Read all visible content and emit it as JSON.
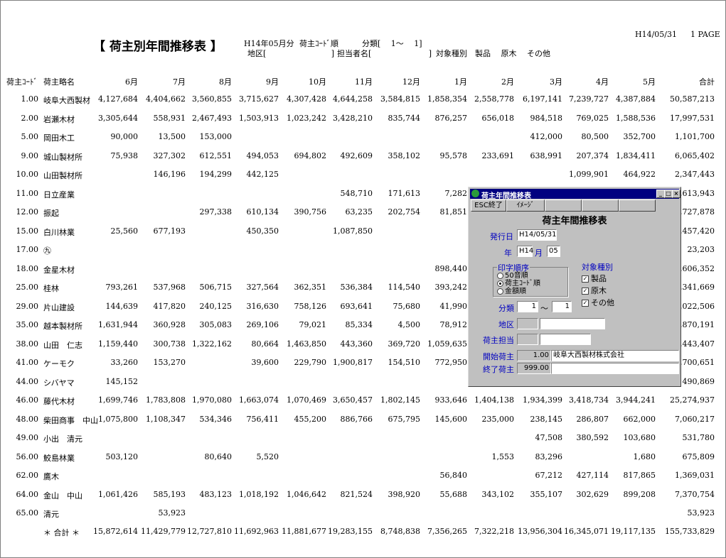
{
  "report": {
    "title": "【 荷主別年間推移表 】",
    "period": "H14年05月分",
    "order": "荷主ｺｰﾄﾞ順",
    "bunrui": "分類[　 1～　 1]",
    "chiku": "地区[　　　　　　　　 ]",
    "tantou": "担当者名[　　　　　　　 ]",
    "target": "対象種別　製品　 原木　 その他",
    "date": "H14/05/31",
    "page": "1 PAGE"
  },
  "columns": [
    "荷主ｺｰﾄﾞ",
    "荷主略名",
    "6月",
    "7月",
    "8月",
    "9月",
    "10月",
    "11月",
    "12月",
    "1月",
    "2月",
    "3月",
    "4月",
    "5月",
    "合計"
  ],
  "rows": [
    {
      "code": "1.00",
      "name": "岐阜大西製材",
      "v": [
        "4,127,684",
        "4,404,662",
        "3,560,855",
        "3,715,627",
        "4,307,428",
        "4,644,258",
        "3,584,815",
        "1,858,354",
        "2,558,778",
        "6,197,141",
        "7,239,727",
        "4,387,884",
        "50,587,213"
      ]
    },
    {
      "code": "2.00",
      "name": "岩瀬木材",
      "v": [
        "3,305,644",
        "558,931",
        "2,467,493",
        "1,503,913",
        "1,023,242",
        "3,428,210",
        "835,744",
        "876,257",
        "656,018",
        "984,518",
        "769,025",
        "1,588,536",
        "17,997,531"
      ]
    },
    {
      "code": "5.00",
      "name": "岡田木工",
      "v": [
        "90,000",
        "13,500",
        "153,000",
        "",
        "",
        "",
        "",
        "",
        "",
        "412,000",
        "80,500",
        "352,700",
        "1,101,700"
      ]
    },
    {
      "code": "9.00",
      "name": "城山製材所",
      "v": [
        "75,938",
        "327,302",
        "612,551",
        "494,053",
        "694,802",
        "492,609",
        "358,102",
        "95,578",
        "233,691",
        "638,991",
        "207,374",
        "1,834,411",
        "6,065,402"
      ]
    },
    {
      "code": "10.00",
      "name": "山田製材所",
      "v": [
        "",
        "146,196",
        "194,299",
        "442,125",
        "",
        "",
        "",
        "",
        "",
        "",
        "1,099,901",
        "464,922",
        "2,347,443"
      ]
    },
    {
      "code": "11.00",
      "name": "日立産業",
      "v": [
        "",
        "",
        "",
        "",
        "",
        "548,710",
        "171,613",
        "7,282",
        "",
        "",
        "",
        "",
        ",613,943"
      ]
    },
    {
      "code": "12.00",
      "name": "振起",
      "v": [
        "",
        "",
        "297,338",
        "610,134",
        "390,756",
        "63,235",
        "202,754",
        "81,851",
        "",
        "",
        "",
        "",
        ",727,878"
      ]
    },
    {
      "code": "15.00",
      "name": "白川林業",
      "v": [
        "25,560",
        "677,193",
        "",
        "450,350",
        "",
        "1,087,850",
        "",
        "",
        "",
        "",
        "",
        "",
        ",457,420"
      ]
    },
    {
      "code": "17.00",
      "name": "㊈",
      "v": [
        "",
        "",
        "",
        "",
        "",
        "",
        "",
        "",
        "",
        "",
        "",
        "",
        "23,203"
      ]
    },
    {
      "code": "18.00",
      "name": "金星木材",
      "v": [
        "",
        "",
        "",
        "",
        "",
        "",
        "",
        "898,440",
        "",
        "",
        "",
        "",
        ",606,352"
      ]
    },
    {
      "code": "25.00",
      "name": "桂林",
      "v": [
        "793,261",
        "537,968",
        "506,715",
        "327,564",
        "362,351",
        "536,384",
        "114,540",
        "393,242",
        "",
        "",
        "",
        "",
        ",341,669"
      ]
    },
    {
      "code": "29.00",
      "name": "片山建設",
      "v": [
        "144,639",
        "417,820",
        "240,125",
        "316,630",
        "758,126",
        "693,641",
        "75,680",
        "41,990",
        "",
        "",
        "",
        "",
        ",022,506"
      ]
    },
    {
      "code": "35.00",
      "name": "越本製材所",
      "v": [
        "1,631,944",
        "360,928",
        "305,083",
        "269,106",
        "79,021",
        "85,334",
        "4,500",
        "78,912",
        "",
        "",
        "",
        "",
        ",870,191"
      ]
    },
    {
      "code": "38.00",
      "name": "山田　仁志",
      "v": [
        "1,159,440",
        "300,738",
        "1,322,162",
        "80,664",
        "1,463,850",
        "443,360",
        "369,720",
        "1,059,635",
        "",
        "",
        "",
        "",
        ",443,407"
      ]
    },
    {
      "code": "41.00",
      "name": "ケーモク",
      "v": [
        "33,260",
        "153,270",
        "",
        "39,600",
        "229,790",
        "1,900,817",
        "154,510",
        "772,950",
        "",
        "",
        "",
        "",
        ",700,651"
      ]
    },
    {
      "code": "44.00",
      "name": "シバヤマ",
      "v": [
        "145,152",
        "",
        "",
        "",
        "",
        "",
        "",
        "",
        "",
        "",
        "",
        "",
        "490,869"
      ]
    },
    {
      "code": "46.00",
      "name": "藤代木材",
      "v": [
        "1,699,746",
        "1,783,808",
        "1,970,080",
        "1,663,074",
        "1,070,469",
        "3,650,457",
        "1,802,145",
        "933,646",
        "1,404,138",
        "1,934,399",
        "3,418,734",
        "3,944,241",
        "25,274,937"
      ]
    },
    {
      "code": "48.00",
      "name": "柴田商事　中山",
      "v": [
        "1,075,800",
        "1,108,347",
        "534,346",
        "756,411",
        "455,200",
        "886,766",
        "675,795",
        "145,600",
        "235,000",
        "238,145",
        "286,807",
        "662,000",
        "7,060,217"
      ]
    },
    {
      "code": "49.00",
      "name": "小出　清元",
      "v": [
        "",
        "",
        "",
        "",
        "",
        "",
        "",
        "",
        "",
        "47,508",
        "380,592",
        "103,680",
        "531,780"
      ]
    },
    {
      "code": "56.00",
      "name": "鮫島林業",
      "v": [
        "503,120",
        "",
        "80,640",
        "5,520",
        "",
        "",
        "",
        "",
        "1,553",
        "83,296",
        "",
        "1,680",
        "675,809"
      ]
    },
    {
      "code": "62.00",
      "name": "鷹木",
      "v": [
        "",
        "",
        "",
        "",
        "",
        "",
        "",
        "56,840",
        "",
        "67,212",
        "427,114",
        "817,865",
        "1,369,031"
      ]
    },
    {
      "code": "64.00",
      "name": "金山　中山",
      "v": [
        "1,061,426",
        "585,193",
        "483,123",
        "1,018,192",
        "1,046,642",
        "821,524",
        "398,920",
        "55,688",
        "343,102",
        "355,107",
        "302,629",
        "899,208",
        "7,370,754"
      ]
    },
    {
      "code": "65.00",
      "name": "清元",
      "v": [
        "",
        "53,923",
        "",
        "",
        "",
        "",
        "",
        "",
        "",
        "",
        "",
        "",
        "53,923"
      ]
    }
  ],
  "total": {
    "label": "＊ 合計 ＊",
    "v": [
      "15,872,614",
      "11,429,779",
      "12,727,810",
      "11,692,963",
      "11,881,677",
      "19,283,155",
      "8,748,838",
      "7,356,265",
      "7,322,218",
      "13,956,304",
      "16,345,071",
      "19,117,135",
      "155,733,829"
    ]
  },
  "dialog": {
    "window_title": "荷主年間推移表",
    "esc_button": "ESC終了",
    "image_button": "ｲﾒｰｼﾞ",
    "heading": "荷主年間推移表",
    "issue_date_label": "発行日",
    "issue_date": "H14/05/31",
    "year_label": "年",
    "year": "H14",
    "month_label": "月",
    "month": "05",
    "print_order_label": "印字順序",
    "opt_50": "50音順",
    "opt_code": "荷主ｺｰﾄﾞ順",
    "opt_amount": "金額順",
    "target_label": "対象種別",
    "chk_product": "製品",
    "chk_log": "原木",
    "chk_other": "その他",
    "check_mark": "✓",
    "bunrui_label": "分類",
    "bunrui_from": "1",
    "tilde": "～",
    "bunrui_to": "1",
    "chiku_label": "地区",
    "tantou_label": "荷主担当",
    "start_label": "開始荷主",
    "start_code": "1.00",
    "start_name": "岐阜大西製材株式会社",
    "end_label": "終了荷主",
    "end_code": "999.00"
  }
}
